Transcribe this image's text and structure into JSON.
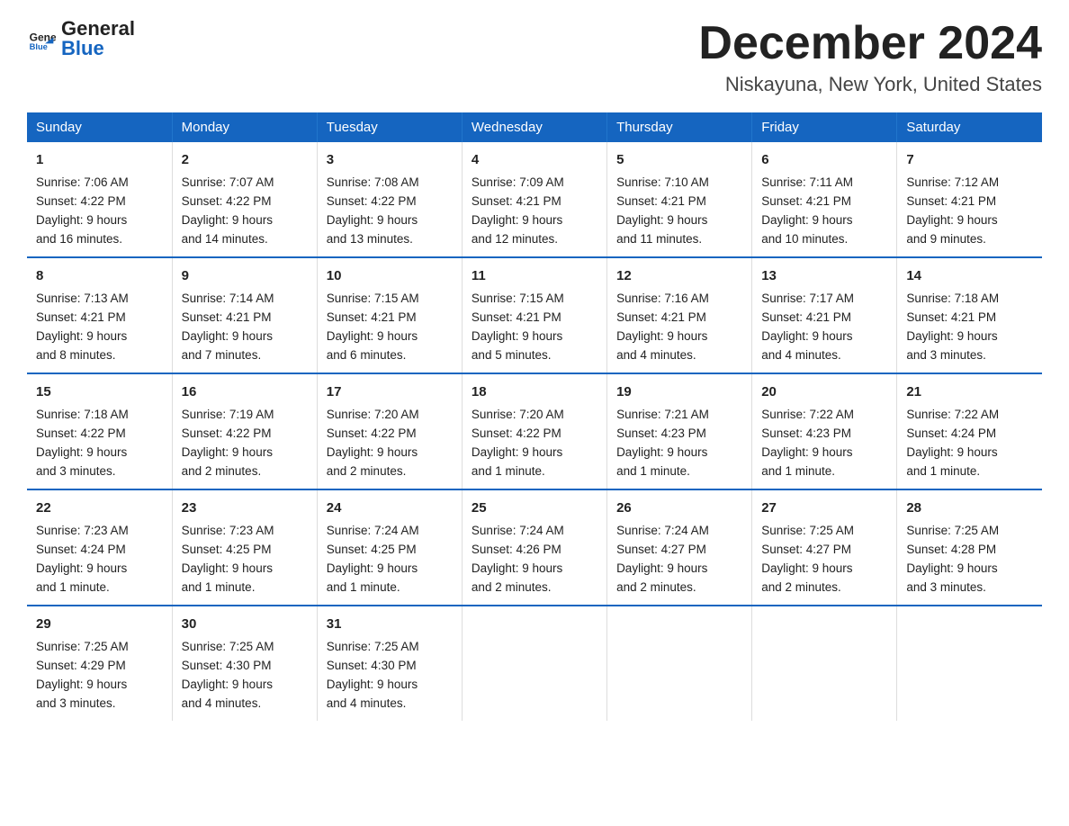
{
  "header": {
    "logo_general": "General",
    "logo_blue": "Blue",
    "main_title": "December 2024",
    "subtitle": "Niskayuna, New York, United States"
  },
  "days_of_week": [
    "Sunday",
    "Monday",
    "Tuesday",
    "Wednesday",
    "Thursday",
    "Friday",
    "Saturday"
  ],
  "weeks": [
    [
      {
        "day": "1",
        "sunrise": "7:06 AM",
        "sunset": "4:22 PM",
        "daylight": "9 hours and 16 minutes."
      },
      {
        "day": "2",
        "sunrise": "7:07 AM",
        "sunset": "4:22 PM",
        "daylight": "9 hours and 14 minutes."
      },
      {
        "day": "3",
        "sunrise": "7:08 AM",
        "sunset": "4:22 PM",
        "daylight": "9 hours and 13 minutes."
      },
      {
        "day": "4",
        "sunrise": "7:09 AM",
        "sunset": "4:21 PM",
        "daylight": "9 hours and 12 minutes."
      },
      {
        "day": "5",
        "sunrise": "7:10 AM",
        "sunset": "4:21 PM",
        "daylight": "9 hours and 11 minutes."
      },
      {
        "day": "6",
        "sunrise": "7:11 AM",
        "sunset": "4:21 PM",
        "daylight": "9 hours and 10 minutes."
      },
      {
        "day": "7",
        "sunrise": "7:12 AM",
        "sunset": "4:21 PM",
        "daylight": "9 hours and 9 minutes."
      }
    ],
    [
      {
        "day": "8",
        "sunrise": "7:13 AM",
        "sunset": "4:21 PM",
        "daylight": "9 hours and 8 minutes."
      },
      {
        "day": "9",
        "sunrise": "7:14 AM",
        "sunset": "4:21 PM",
        "daylight": "9 hours and 7 minutes."
      },
      {
        "day": "10",
        "sunrise": "7:15 AM",
        "sunset": "4:21 PM",
        "daylight": "9 hours and 6 minutes."
      },
      {
        "day": "11",
        "sunrise": "7:15 AM",
        "sunset": "4:21 PM",
        "daylight": "9 hours and 5 minutes."
      },
      {
        "day": "12",
        "sunrise": "7:16 AM",
        "sunset": "4:21 PM",
        "daylight": "9 hours and 4 minutes."
      },
      {
        "day": "13",
        "sunrise": "7:17 AM",
        "sunset": "4:21 PM",
        "daylight": "9 hours and 4 minutes."
      },
      {
        "day": "14",
        "sunrise": "7:18 AM",
        "sunset": "4:21 PM",
        "daylight": "9 hours and 3 minutes."
      }
    ],
    [
      {
        "day": "15",
        "sunrise": "7:18 AM",
        "sunset": "4:22 PM",
        "daylight": "9 hours and 3 minutes."
      },
      {
        "day": "16",
        "sunrise": "7:19 AM",
        "sunset": "4:22 PM",
        "daylight": "9 hours and 2 minutes."
      },
      {
        "day": "17",
        "sunrise": "7:20 AM",
        "sunset": "4:22 PM",
        "daylight": "9 hours and 2 minutes."
      },
      {
        "day": "18",
        "sunrise": "7:20 AM",
        "sunset": "4:22 PM",
        "daylight": "9 hours and 1 minute."
      },
      {
        "day": "19",
        "sunrise": "7:21 AM",
        "sunset": "4:23 PM",
        "daylight": "9 hours and 1 minute."
      },
      {
        "day": "20",
        "sunrise": "7:22 AM",
        "sunset": "4:23 PM",
        "daylight": "9 hours and 1 minute."
      },
      {
        "day": "21",
        "sunrise": "7:22 AM",
        "sunset": "4:24 PM",
        "daylight": "9 hours and 1 minute."
      }
    ],
    [
      {
        "day": "22",
        "sunrise": "7:23 AM",
        "sunset": "4:24 PM",
        "daylight": "9 hours and 1 minute."
      },
      {
        "day": "23",
        "sunrise": "7:23 AM",
        "sunset": "4:25 PM",
        "daylight": "9 hours and 1 minute."
      },
      {
        "day": "24",
        "sunrise": "7:24 AM",
        "sunset": "4:25 PM",
        "daylight": "9 hours and 1 minute."
      },
      {
        "day": "25",
        "sunrise": "7:24 AM",
        "sunset": "4:26 PM",
        "daylight": "9 hours and 2 minutes."
      },
      {
        "day": "26",
        "sunrise": "7:24 AM",
        "sunset": "4:27 PM",
        "daylight": "9 hours and 2 minutes."
      },
      {
        "day": "27",
        "sunrise": "7:25 AM",
        "sunset": "4:27 PM",
        "daylight": "9 hours and 2 minutes."
      },
      {
        "day": "28",
        "sunrise": "7:25 AM",
        "sunset": "4:28 PM",
        "daylight": "9 hours and 3 minutes."
      }
    ],
    [
      {
        "day": "29",
        "sunrise": "7:25 AM",
        "sunset": "4:29 PM",
        "daylight": "9 hours and 3 minutes."
      },
      {
        "day": "30",
        "sunrise": "7:25 AM",
        "sunset": "4:30 PM",
        "daylight": "9 hours and 4 minutes."
      },
      {
        "day": "31",
        "sunrise": "7:25 AM",
        "sunset": "4:30 PM",
        "daylight": "9 hours and 4 minutes."
      },
      null,
      null,
      null,
      null
    ]
  ],
  "labels": {
    "sunrise": "Sunrise:",
    "sunset": "Sunset:",
    "daylight": "Daylight:"
  }
}
